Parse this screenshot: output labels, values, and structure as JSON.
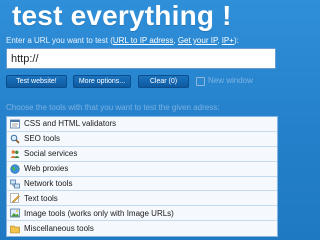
{
  "header": {
    "title": "test everything !"
  },
  "prompt": {
    "before": "Enter a URL you want to test (",
    "link_url_to_ip": "URL to IP adress",
    "sep1": ", ",
    "link_get_ip": "Get your IP",
    "sep2": ", ",
    "link_ipplus": "IP+",
    "after": "):"
  },
  "url_input": {
    "value": "http://"
  },
  "buttons": {
    "test": "Test website!",
    "more": "More options...",
    "clear": "Clear (0)"
  },
  "new_window": {
    "label": "New window",
    "checked": false
  },
  "choose_label": "Choose the tools with that you want to test the given adress:",
  "tools": [
    {
      "label": "CSS and HTML validators",
      "icon": "validator-icon"
    },
    {
      "label": "SEO tools",
      "icon": "magnifier-icon"
    },
    {
      "label": "Social services",
      "icon": "people-icon"
    },
    {
      "label": "Web proxies",
      "icon": "globe-icon"
    },
    {
      "label": "Network tools",
      "icon": "network-icon"
    },
    {
      "label": "Text tools",
      "icon": "pencil-icon"
    },
    {
      "label": "Image tools (works only with Image URLs)",
      "icon": "image-icon"
    },
    {
      "label": "Miscellaneous tools",
      "icon": "folder-icon"
    }
  ],
  "colors": {
    "background": "#2581cb",
    "button": "#0e5aa1",
    "list_bg": "#f5f9fd",
    "muted_text": "#7cb2e2"
  }
}
